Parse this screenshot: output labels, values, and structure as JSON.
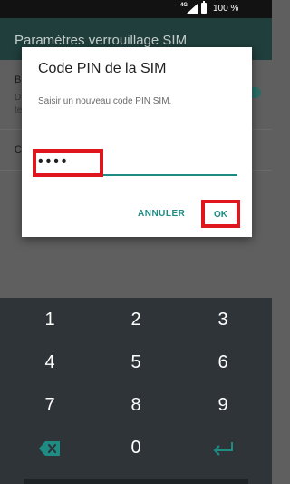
{
  "status_bar": {
    "network": "4G",
    "battery_pct": "100 %"
  },
  "background": {
    "app_title": "Paramètres verrouillage SIM",
    "row1_title": "B",
    "row1_sub1": "D",
    "row1_sub2": "te",
    "row2_title": "C"
  },
  "dialog": {
    "title": "Code PIN de la SIM",
    "message": "Saisir un nouveau code PIN SIM.",
    "pin_value": "••••",
    "cancel_label": "ANNULER",
    "ok_label": "OK"
  },
  "keypad": {
    "keys": [
      "1",
      "2",
      "3",
      "4",
      "5",
      "6",
      "7",
      "8",
      "9",
      "0"
    ],
    "delete_icon": "backspace-icon",
    "enter_icon": "enter-icon"
  },
  "colors": {
    "accent": "#1f8c84",
    "highlight": "#e0161f",
    "keypad_bg": "#2e3438"
  }
}
